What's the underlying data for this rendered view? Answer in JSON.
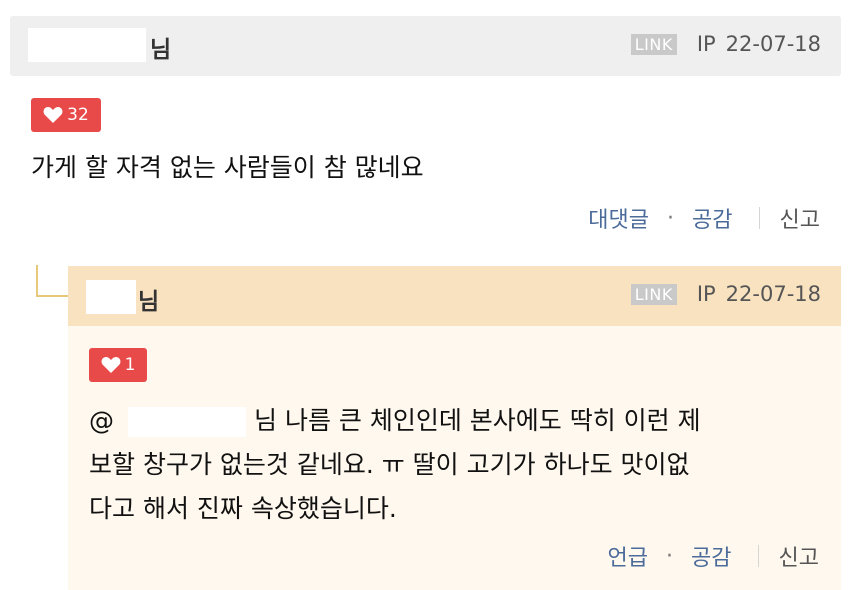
{
  "comment": {
    "name_suffix": "님",
    "link_label": "LINK",
    "ip_label": "IP",
    "date": "22-07-18",
    "likes": "32",
    "text": "가게 할 자격 없는 사람들이 참 많네요",
    "actions": {
      "reply": "대댓글",
      "sympathy": "공감",
      "report": "신고"
    }
  },
  "reply": {
    "name_suffix": "님",
    "link_label": "LINK",
    "ip_label": "IP",
    "date": "22-07-18",
    "likes": "1",
    "mention_at": "@",
    "line1_rest": "님 나름 큰 체인인데 본사에도 딱히 이런 제",
    "line2": "보할 창구가 없는것 같네요. ㅠ 딸이 고기가 하나도 맛이없",
    "line3": "다고 해서 진짜 속상했습니다.",
    "actions": {
      "mention": "언급",
      "sympathy": "공감",
      "report": "신고"
    }
  },
  "colors": {
    "like_red": "#e84a4a",
    "action_blue": "#4b6b9a",
    "reply_header_bg": "#f9e2c0",
    "reply_body_bg": "#fff8ee"
  }
}
